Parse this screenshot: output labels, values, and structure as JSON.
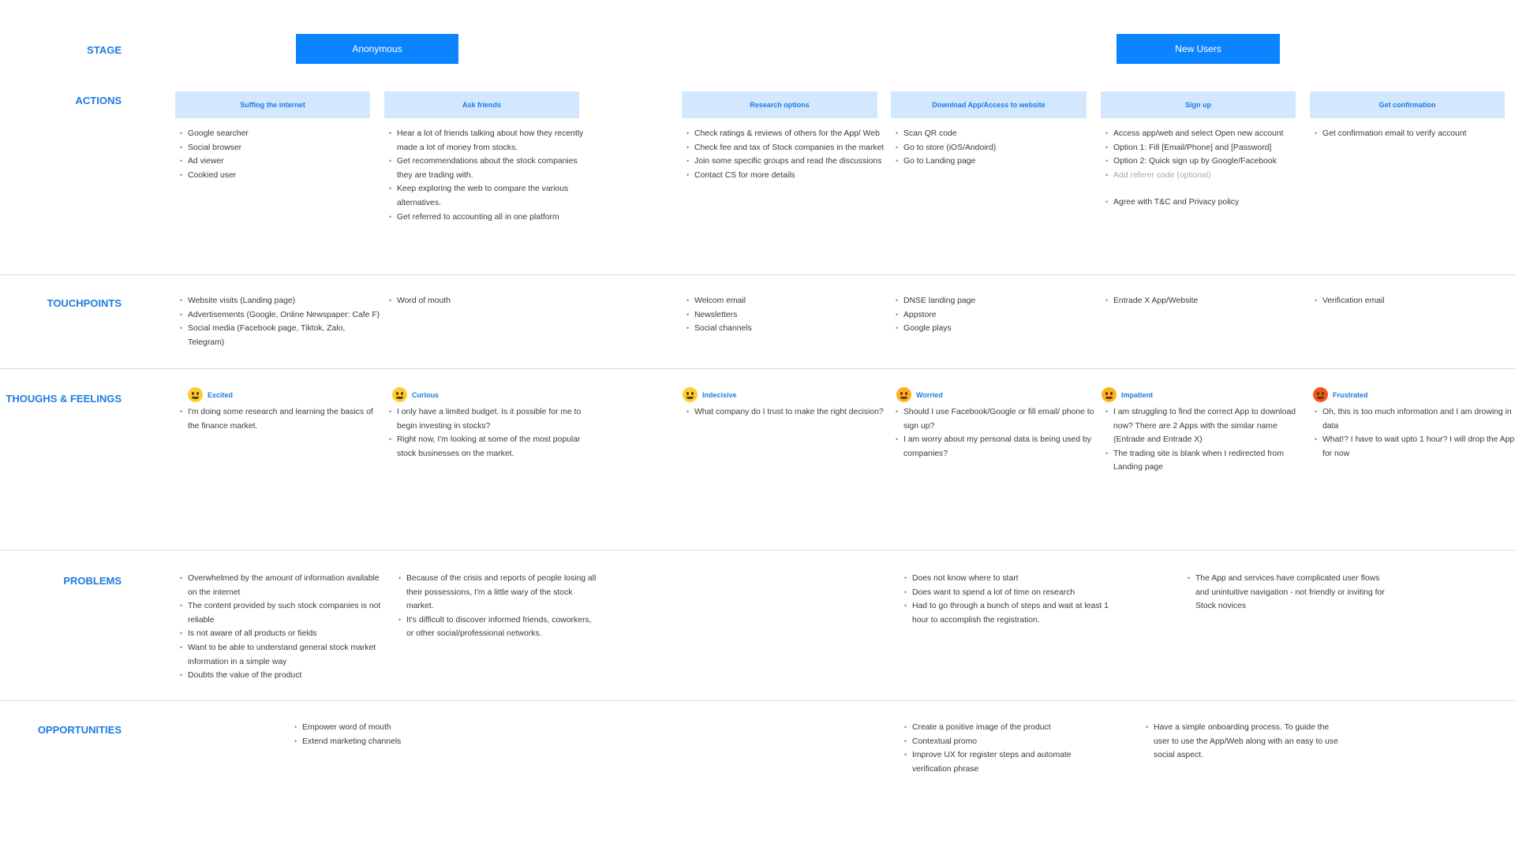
{
  "row_labels": {
    "stage": "STAGE",
    "actions": "ACTIONS",
    "touchpoints": "TOUCHPOINTS",
    "thoughts": "THOUGHS & FEELINGS",
    "problems": "PROBLEMS",
    "opportunities": "OPPORTUNITIES"
  },
  "stages": [
    "Anonymous",
    "New Users"
  ],
  "actions": [
    {
      "label": "Suffing the internet",
      "items": [
        "Google searcher",
        "Social browser",
        "Ad viewer",
        "Cookied user"
      ]
    },
    {
      "label": "Ask friends",
      "items": [
        "Hear a lot of friends talking about how they recently made a lot of money from stocks.",
        "Get recommendations about the stock companies they are trading with.",
        " Keep exploring the web to compare the various alternatives.",
        "Get referred to accounting all in one platform"
      ]
    },
    {
      "label": "Research options",
      "items": [
        "Check ratings & reviews of others for the App/ Web",
        "Check fee and tax of Stock companies in the market",
        "Join some specific groups and read the discussions",
        "Contact CS for more details"
      ]
    },
    {
      "label": "Download App/Access to website",
      "items": [
        "Scan QR code",
        "Go to store (iOS/Andoird)",
        "Go to Landing page"
      ]
    },
    {
      "label": "Sign up",
      "items": [
        "Access app/web and select Open new account",
        "Option 1: Fill [Email/Phone] and [Password]",
        "Option 2: Quick sign up by Google/Facebook",
        "Add referer code (optional)",
        "Agree with T&C and Privacy policy"
      ]
    },
    {
      "label": "Get confirmation",
      "items": [
        "Get confirmation email to verify account"
      ]
    }
  ],
  "touchpoints": [
    [
      "Website visits (Landing page)",
      "Advertisements (Google, Online Newspaper: Cafe F)",
      "Social media (Facebook page, Tiktok, Zalo, Telegram)"
    ],
    [
      "Word of mouth"
    ],
    [
      "Welcom email",
      "Newsletters",
      "Social channels"
    ],
    [
      "DNSE landing page",
      "Appstore",
      "Google plays"
    ],
    [
      "Entrade X App/Website"
    ],
    [
      "Verification email"
    ]
  ],
  "feelings": [
    {
      "emotion": "Excited",
      "icon": "grinning-face-icon",
      "color": "#ffcc2e",
      "items": [
        "I'm doing some research and learning the basics of the finance market."
      ]
    },
    {
      "emotion": "Curious",
      "icon": "thinking-face-icon",
      "color": "#ffcc2e",
      "items": [
        "I only have a limited budget. Is it possible for me to begin investing in stocks?",
        "Right now, I'm looking at some of the most popular stock businesses on the market."
      ]
    },
    {
      "emotion": "Indecisive",
      "icon": "confused-face-icon",
      "color": "#ffcc2e",
      "items": [
        "What company do I trust to make the right decision?"
      ]
    },
    {
      "emotion": "Worried",
      "icon": "worried-face-icon",
      "color": "#ffb020",
      "items": [
        "Should I use Facebook/Google or fill email/ phone to sign up?",
        "I am worry about my personal data is being used by companies?"
      ]
    },
    {
      "emotion": "Impatient",
      "icon": "frowning-face-icon",
      "color": "#ffb020",
      "items": [
        "I am struggling to find the correct App to download now? There are 2 Apps with the similar name (Entrade and Entrade X)",
        "The trading site is blank when I redirected from Landing page"
      ]
    },
    {
      "emotion": "Frustrated",
      "icon": "angry-face-icon",
      "color": "#f4541e",
      "items": [
        "Oh, this is too much information and I am drowing in data",
        "What!? I have to wait upto 1 hour? I will drop the App for now"
      ]
    }
  ],
  "problems": [
    [
      "Overwhelmed by the amount of information available on the internet",
      "The content provided by such stock companies is not reliable",
      "Is not aware of all products or fields",
      "Want to be able to understand general stock market information in a simple way",
      "Doubts the value of the product"
    ],
    [
      "Because of the crisis and reports of people losing all their possessions, I'm a little wary of the stock market.",
      "It's difficult to discover informed friends, coworkers, or other social/professional networks."
    ],
    [
      "Does not know where to start",
      "Does want to spend a lot of time on research",
      "Had to go through a bunch of steps and wait at least 1 hour to accomplish the registration."
    ],
    [
      "The App and services have complicated user flows and unintuitive navigation - not friendly or inviting for Stock novices"
    ]
  ],
  "opportunities": [
    [
      "Empower word of mouth",
      "Extend marketing channels"
    ],
    [
      "Create a positive image of the product",
      "Contextual promo",
      "Improve UX for register steps and automate verification phrase"
    ],
    [
      "Have a simple onboarding process. To guide the user to use the App/Web along with an easy to use social aspect."
    ]
  ],
  "colors": {
    "accent": "#0a84ff",
    "label": "#1e7be0",
    "action_bg": "#d3e8ff"
  }
}
